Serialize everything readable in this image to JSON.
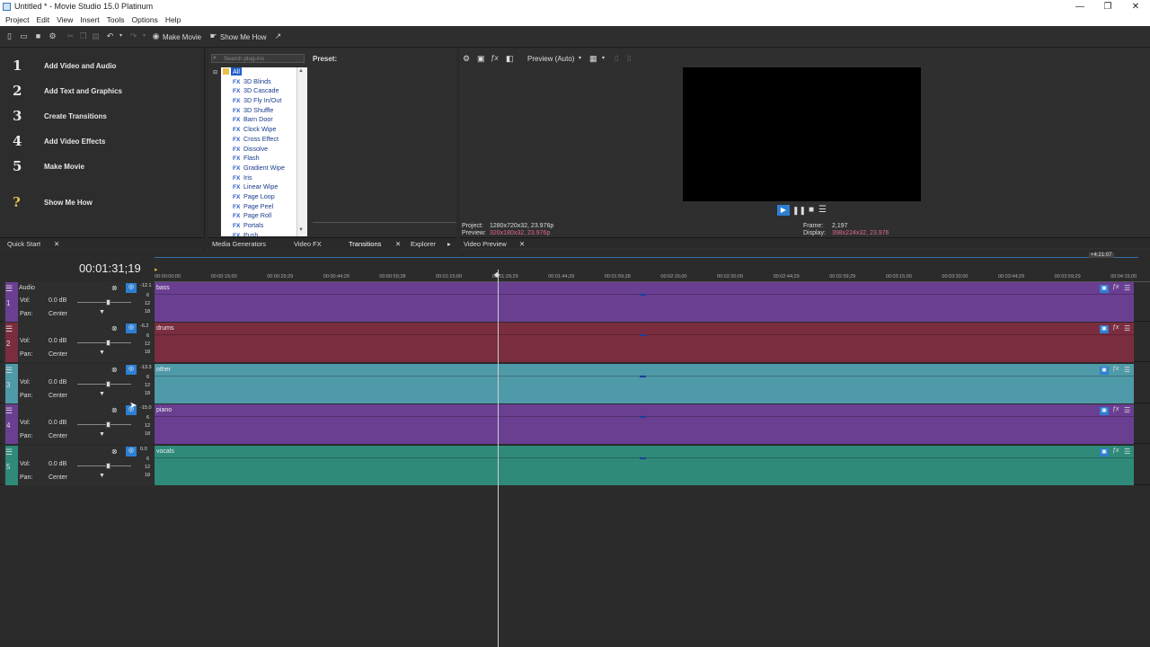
{
  "window": {
    "title": "Untitled * - Movie Studio 15.0 Platinum",
    "minimize": "—",
    "restore": "❐",
    "close": "✕"
  },
  "menu": [
    "Project",
    "Edit",
    "View",
    "Insert",
    "Tools",
    "Options",
    "Help"
  ],
  "toolbar": {
    "make_movie": "Make Movie",
    "show_me_how": "Show Me How"
  },
  "quickstart": {
    "items": [
      {
        "num": "1",
        "label": "Add Video and Audio"
      },
      {
        "num": "2",
        "label": "Add Text and Graphics"
      },
      {
        "num": "3",
        "label": "Create Transitions"
      },
      {
        "num": "4",
        "label": "Add Video Effects"
      },
      {
        "num": "5",
        "label": "Make Movie"
      },
      {
        "num": "?",
        "label": "Show Me How"
      }
    ],
    "tab": "Quick Start"
  },
  "fx": {
    "search_placeholder": "Search plug-ins",
    "preset_label": "Preset:",
    "root": "All",
    "items": [
      "3D Blinds",
      "3D Cascade",
      "3D Fly In/Out",
      "3D Shuffle",
      "Barn Door",
      "Clock Wipe",
      "Cross Effect",
      "Dissolve",
      "Flash",
      "Gradient Wipe",
      "Iris",
      "Linear Wipe",
      "Page Loop",
      "Page Peel",
      "Page Roll",
      "Portals",
      "Push"
    ],
    "fx_tag": "FX",
    "tabs": [
      "Media Generators",
      "Video FX",
      "Transitions",
      "Explorer"
    ]
  },
  "preview": {
    "mode": "Preview (Auto)",
    "project": "Project:",
    "project_val": "1280x720x32, 23.976p",
    "preview": "Preview:",
    "preview_val": "320x180x32, 23.976p",
    "frame": "Frame:",
    "frame_val": "2,197",
    "display": "Display:",
    "display_val": "398x224x32, 23.976",
    "tab": "Video Preview"
  },
  "timeline": {
    "timecode": "00:01:31;19",
    "end_marker": "+4:21:07",
    "ruler": [
      "00:00:00;00",
      "00:00:15;00",
      "00:00:29;29",
      "00:00:44;29",
      "00:00:59;28",
      "00:01:15;00",
      "00:01:29;29",
      "00:01:44;29",
      "00:01:59;28",
      "00:02:15;00",
      "00:02:30;00",
      "00:02:44;29",
      "00:02:59;29",
      "00:03:15;00",
      "00:03:30;00",
      "00:03:44;29",
      "00:03:59;29",
      "00:04:15;00"
    ],
    "tracks": [
      {
        "num": "1",
        "name": "Audio",
        "clip": "bass",
        "vol": "0.0 dB",
        "pan": "Center",
        "meter": "-12.1",
        "color": "#6a3f92",
        "stripe": "#6a3f92"
      },
      {
        "num": "2",
        "name": "",
        "clip": "drums",
        "vol": "0.0 dB",
        "pan": "Center",
        "meter": "-6.2",
        "color": "#7b2d40",
        "stripe": "#7b2d40"
      },
      {
        "num": "3",
        "name": "",
        "clip": "other",
        "vol": "0.0 dB",
        "pan": "Center",
        "meter": "-13.3",
        "color": "#4f9aa8",
        "stripe": "#4f9aa8"
      },
      {
        "num": "4",
        "name": "",
        "clip": "piano",
        "vol": "0.0 dB",
        "pan": "Center",
        "meter": "-15.0",
        "color": "#6a3f92",
        "stripe": "#6a3f92"
      },
      {
        "num": "5",
        "name": "",
        "clip": "vocals",
        "vol": "0.0 dB",
        "pan": "Center",
        "meter": "0.0",
        "color": "#2f8a7a",
        "stripe": "#2f8a7a"
      }
    ],
    "vol_label": "Vol:",
    "pan_label": "Pan:",
    "meter_ticks": [
      "6",
      "12",
      "18"
    ]
  }
}
